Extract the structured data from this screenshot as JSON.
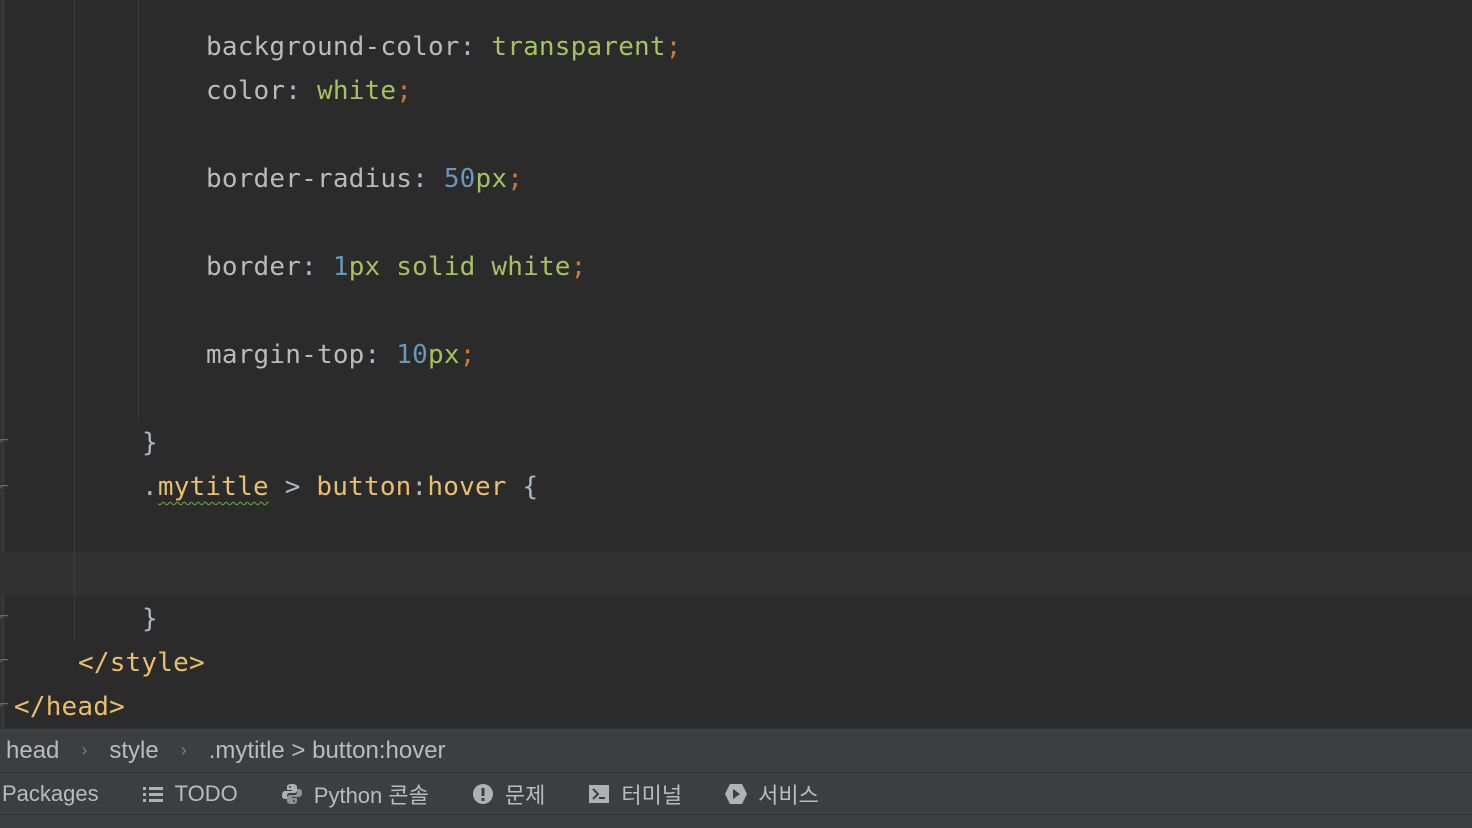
{
  "editor": {
    "lines": [
      {
        "tokens": [
          {
            "t": "prop",
            "v": "background-color"
          },
          {
            "t": "plain",
            "v": ": "
          },
          {
            "t": "val",
            "v": "transparent"
          },
          {
            "t": "semi",
            "v": ";"
          }
        ]
      },
      {
        "tokens": [
          {
            "t": "prop",
            "v": "color"
          },
          {
            "t": "plain",
            "v": ": "
          },
          {
            "t": "val",
            "v": "white"
          },
          {
            "t": "semi",
            "v": ";"
          }
        ]
      },
      {
        "tokens": [
          {
            "t": "prop",
            "v": "border-radius"
          },
          {
            "t": "plain",
            "v": ": "
          },
          {
            "t": "num",
            "v": "50"
          },
          {
            "t": "val",
            "v": "px"
          },
          {
            "t": "semi",
            "v": ";"
          }
        ]
      },
      {
        "tokens": [
          {
            "t": "prop",
            "v": "border"
          },
          {
            "t": "plain",
            "v": ": "
          },
          {
            "t": "num",
            "v": "1"
          },
          {
            "t": "val",
            "v": "px solid white"
          },
          {
            "t": "semi",
            "v": ";"
          }
        ]
      },
      {
        "tokens": [
          {
            "t": "prop",
            "v": "margin-top"
          },
          {
            "t": "plain",
            "v": ": "
          },
          {
            "t": "num",
            "v": "10"
          },
          {
            "t": "val",
            "v": "px"
          },
          {
            "t": "semi",
            "v": ";"
          }
        ]
      },
      {
        "tokens": [
          {
            "t": "plain",
            "v": "}"
          }
        ]
      },
      {
        "tokens": [
          {
            "t": "plain",
            "v": "."
          },
          {
            "t": "sel-squiggle",
            "v": "mytitle"
          },
          {
            "t": "plain",
            "v": " > "
          },
          {
            "t": "sel",
            "v": "button"
          },
          {
            "t": "plain",
            "v": ":"
          },
          {
            "t": "sel",
            "v": "hover"
          },
          {
            "t": "plain",
            "v": " {"
          }
        ]
      },
      {
        "tokens": []
      },
      {
        "tokens": [
          {
            "t": "plain",
            "v": "}"
          }
        ]
      },
      {
        "tokens": [
          {
            "t": "tag",
            "v": "</style>"
          }
        ]
      },
      {
        "tokens": [
          {
            "t": "tag",
            "v": "</head>"
          }
        ]
      }
    ]
  },
  "breadcrumb": {
    "items": [
      "head",
      "style",
      ".mytitle > button:hover"
    ],
    "separator": "›"
  },
  "toolwindows": [
    {
      "label": "Packages",
      "icon": ""
    },
    {
      "label": "TODO",
      "icon": "list-icon"
    },
    {
      "label": "Python 콘솔",
      "icon": "python-icon"
    },
    {
      "label": "문제",
      "icon": "problems-icon"
    },
    {
      "label": "터미널",
      "icon": "terminal-icon"
    },
    {
      "label": "서비스",
      "icon": "services-icon"
    }
  ],
  "colors": {
    "background": "#2b2b2b",
    "property": "#bababa",
    "value": "#a5c261",
    "number": "#6897bb",
    "semicolon": "#cc7832",
    "selector": "#e8bf6a"
  }
}
